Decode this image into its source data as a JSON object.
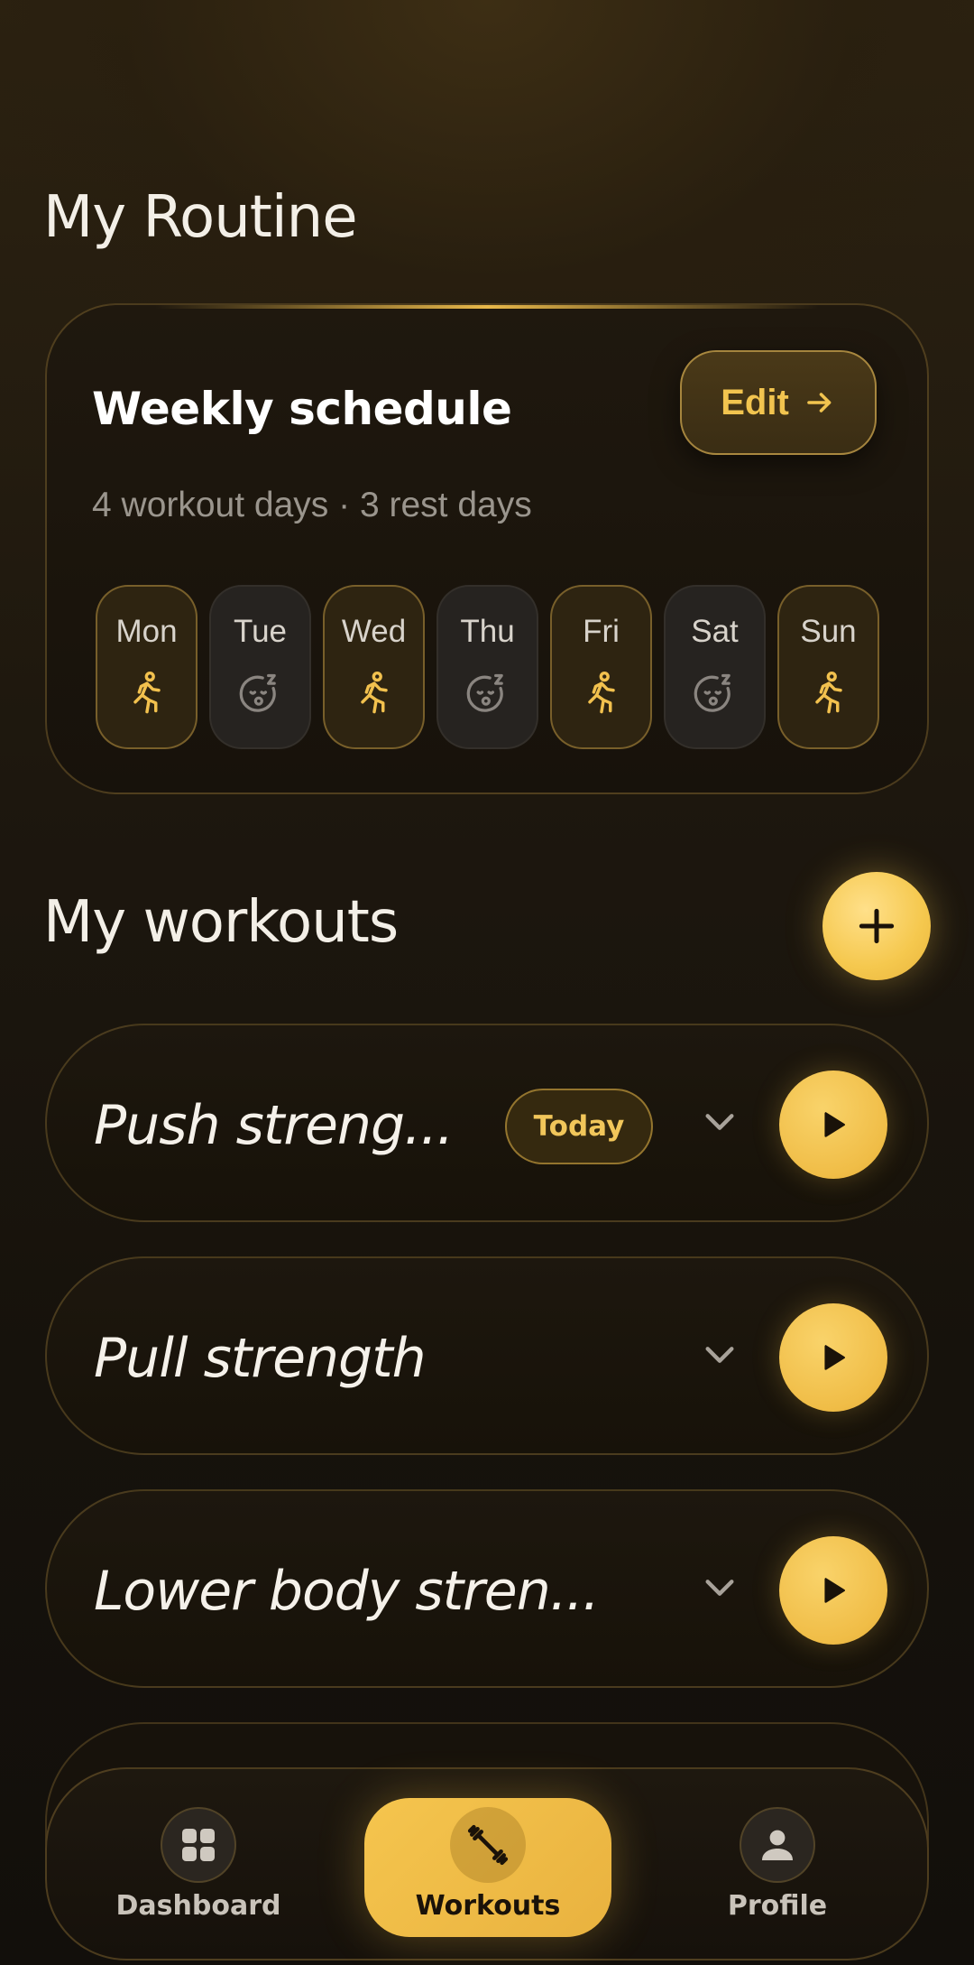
{
  "routine": {
    "heading": "My Routine",
    "schedule": {
      "title": "Weekly schedule",
      "edit_label": "Edit",
      "summary": "4 workout days · 3 rest days",
      "days": [
        {
          "label": "Mon",
          "type": "workout"
        },
        {
          "label": "Tue",
          "type": "rest"
        },
        {
          "label": "Wed",
          "type": "workout"
        },
        {
          "label": "Thu",
          "type": "rest"
        },
        {
          "label": "Fri",
          "type": "workout"
        },
        {
          "label": "Sat",
          "type": "rest"
        },
        {
          "label": "Sun",
          "type": "workout"
        }
      ]
    }
  },
  "workouts": {
    "heading": "My workouts",
    "add_icon": "plus-icon",
    "items": [
      {
        "name": "Push streng...",
        "badge": "Today"
      },
      {
        "name": "Pull strength"
      },
      {
        "name": "Lower body stren..."
      }
    ]
  },
  "nav": {
    "items": [
      {
        "label": "Dashboard",
        "icon": "grid-icon"
      },
      {
        "label": "Workouts",
        "icon": "dumbbell-icon",
        "active": true
      },
      {
        "label": "Profile",
        "icon": "person-icon"
      }
    ]
  },
  "colors": {
    "accent": "#f2c14e",
    "background": "#1a150d",
    "rest_icon": "#8a8580"
  }
}
